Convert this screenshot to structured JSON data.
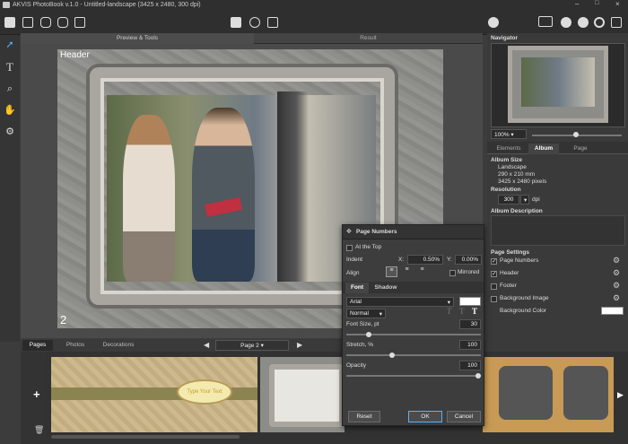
{
  "app": {
    "title": "AKVIS PhotoBook v.1.0 - Untitled-landscape (3425 x 2480, 300 dpi)"
  },
  "tabs": {
    "preview": "Preview & Tools",
    "result": "Result"
  },
  "canvas": {
    "header_label": "Header",
    "page_number": "2"
  },
  "navigator": {
    "title": "Navigator",
    "zoom": "100%",
    "tabs": {
      "elements": "Elements",
      "album": "Album",
      "page": "Page"
    },
    "album_size_label": "Album Size",
    "orientation": "Landscape",
    "size_mm": "290 x 210 mm",
    "size_px": "3425 x 2480 pixels",
    "resolution_label": "Resolution",
    "resolution_value": "300",
    "dpi": "dpi",
    "album_description_label": "Album Description",
    "page_settings_label": "Page Settings",
    "settings": [
      {
        "label": "Page Numbers",
        "checked": true
      },
      {
        "label": "Header",
        "checked": true
      },
      {
        "label": "Footer",
        "checked": false
      },
      {
        "label": "Background Image",
        "checked": false
      }
    ],
    "background_color_label": "Background Color"
  },
  "dialog": {
    "title": "Page Numbers",
    "at_top": "At the Top",
    "indent_label": "Indent",
    "x_label": "X:",
    "x_value": "0.50%",
    "y_label": "Y:",
    "y_value": "0.00%",
    "align_label": "Align",
    "mirrored_label": "Mirrored",
    "tab_font": "Font",
    "tab_shadow": "Shadow",
    "font_name": "Arial",
    "font_style": "Normal",
    "font_size_label": "Font Size, pt",
    "font_size_value": "30",
    "stretch_label": "Stretch, %",
    "stretch_value": "100",
    "opacity_label": "Opacity",
    "opacity_value": "100",
    "reset": "Reset",
    "ok": "OK",
    "cancel": "Cancel"
  },
  "bottom": {
    "tabs": [
      "Pages",
      "Photos",
      "Decorations"
    ],
    "page_select": "Page 2",
    "thumb_text": "Type Your Text"
  }
}
